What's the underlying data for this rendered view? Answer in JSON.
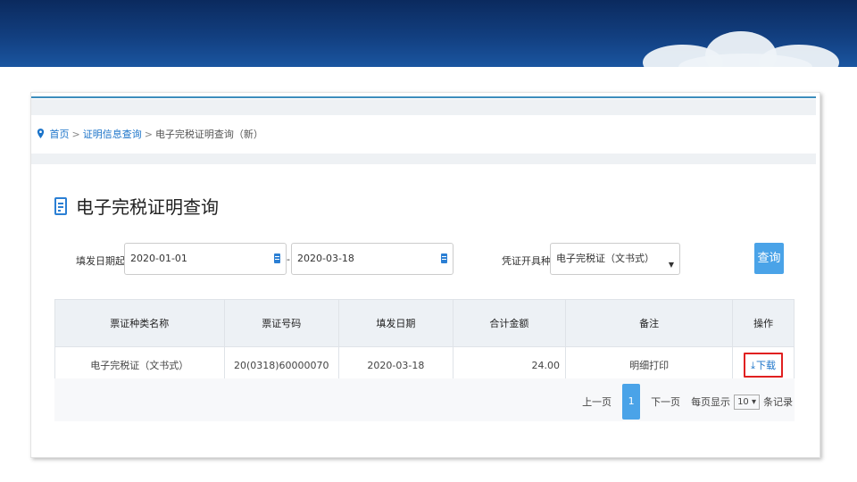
{
  "colors": {
    "banner": "#123f80",
    "accent": "#4aa3e8",
    "link": "#1a73c9",
    "highlight": "#e02020"
  },
  "breadcrumb": {
    "icon": "map-pin-icon",
    "home": "首页",
    "sep1": ">",
    "level2": "证明信息查询",
    "sep2": ">",
    "current": "电子完税证明查询（新）"
  },
  "page": {
    "title": "电子完税证明查询",
    "title_icon": "document-icon"
  },
  "form": {
    "date_label": "填发日期起止：",
    "date_start": "2020-01-01",
    "dash": "-",
    "date_end": "2020-03-18",
    "type_label": "凭证开具种类：",
    "type_value": "电子完税证（文书式）",
    "type_arrow": "▼",
    "query_button": "查询"
  },
  "table": {
    "columns": [
      "票证种类名称",
      "票证号码",
      "填发日期",
      "合计金额",
      "备注",
      "操作"
    ],
    "rows": [
      {
        "type": "电子完税证（文书式）",
        "number": "20(0318)60000070",
        "date": "2020-03-18",
        "amount": "24.00",
        "note": "明细打印",
        "action": "下载",
        "action_icon": "download-icon"
      }
    ]
  },
  "pager": {
    "prev": "上一页",
    "current": "1",
    "next": "下一页",
    "per_page_label": "每页显示",
    "per_page": "10 ▾",
    "unit": "条记录"
  }
}
